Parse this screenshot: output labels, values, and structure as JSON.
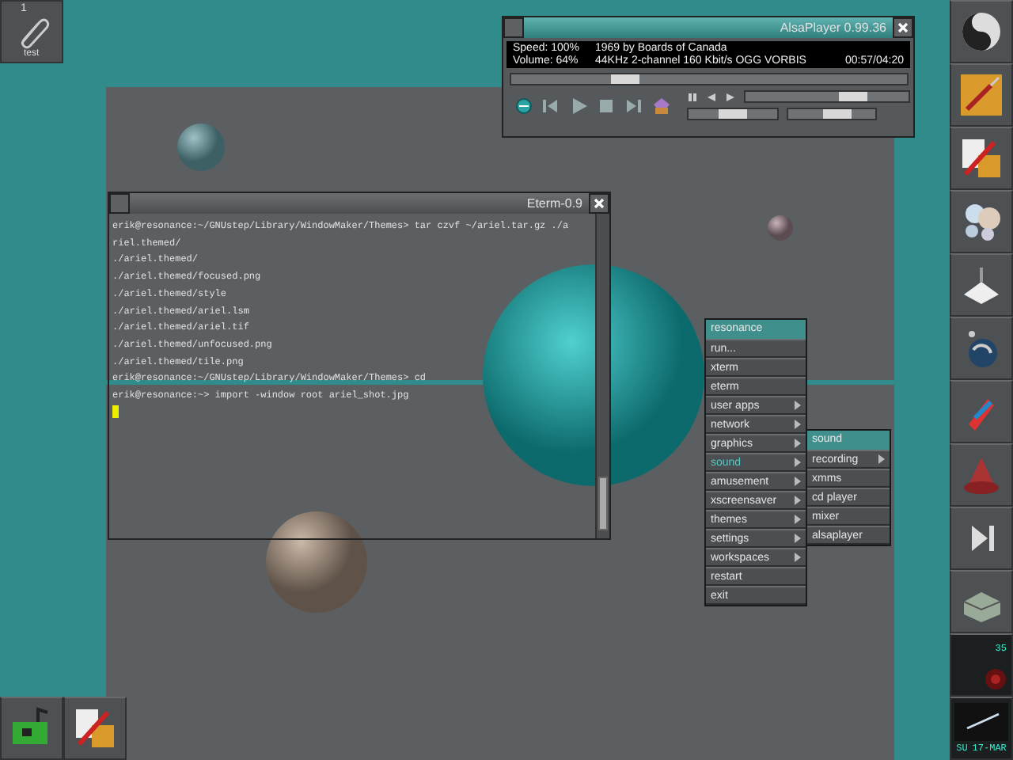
{
  "clip": {
    "workspace": "1",
    "name": "test"
  },
  "alsaplayer": {
    "title": "AlsaPlayer 0.99.36",
    "focused": true,
    "speed": "Speed: 100%",
    "song": "1969 by Boards of Canada",
    "volume": "Volume: 64%",
    "format": "44KHz 2-channel 160 Kbit/s OGG VORBIS",
    "time": "00:57/04:20",
    "seek": {
      "level": 0.27
    },
    "speed_slider": {
      "level": 0.7
    },
    "volume_slider": {
      "level": 0.5
    },
    "balance_slider": {
      "level": 0.6
    }
  },
  "terminal": {
    "title": "Eterm-0.9",
    "focused": false,
    "lines": [
      "erik@resonance:~/GNUstep/Library/WindowMaker/Themes> tar czvf ~/ariel.tar.gz ./a",
      "riel.themed/",
      "./ariel.themed/",
      "./ariel.themed/focused.png",
      "./ariel.themed/style",
      "./ariel.themed/ariel.lsm",
      "./ariel.themed/ariel.tif",
      "./ariel.themed/unfocused.png",
      "./ariel.themed/tile.png",
      "erik@resonance:~/GNUstep/Library/WindowMaker/Themes> cd",
      "erik@resonance:~> import -window root ariel_shot.jpg"
    ]
  },
  "menu": {
    "title": "resonance",
    "items": [
      {
        "label": "run...",
        "submenu": false,
        "selected": false
      },
      {
        "label": "xterm",
        "submenu": false,
        "selected": false
      },
      {
        "label": "eterm",
        "submenu": false,
        "selected": false
      },
      {
        "label": "user apps",
        "submenu": true,
        "selected": false
      },
      {
        "label": "network",
        "submenu": true,
        "selected": false
      },
      {
        "label": "graphics",
        "submenu": true,
        "selected": false
      },
      {
        "label": "sound",
        "submenu": true,
        "selected": true
      },
      {
        "label": "amusement",
        "submenu": true,
        "selected": false
      },
      {
        "label": "xscreensaver",
        "submenu": true,
        "selected": false
      },
      {
        "label": "themes",
        "submenu": true,
        "selected": false
      },
      {
        "label": "settings",
        "submenu": true,
        "selected": false
      },
      {
        "label": "workspaces",
        "submenu": true,
        "selected": false
      },
      {
        "label": "restart",
        "submenu": false,
        "selected": false
      },
      {
        "label": "exit",
        "submenu": false,
        "selected": false
      }
    ]
  },
  "submenu": {
    "title": "sound",
    "items": [
      {
        "label": "recording",
        "submenu": true,
        "selected": false
      },
      {
        "label": "xmms",
        "submenu": false,
        "selected": false
      },
      {
        "label": "cd player",
        "submenu": false,
        "selected": false
      },
      {
        "label": "mixer",
        "submenu": false,
        "selected": false
      },
      {
        "label": "alsaplayer",
        "submenu": false,
        "selected": false
      }
    ]
  },
  "dockapps": {
    "mixer_value": "35",
    "day": "SU",
    "date": "17-MAR"
  }
}
